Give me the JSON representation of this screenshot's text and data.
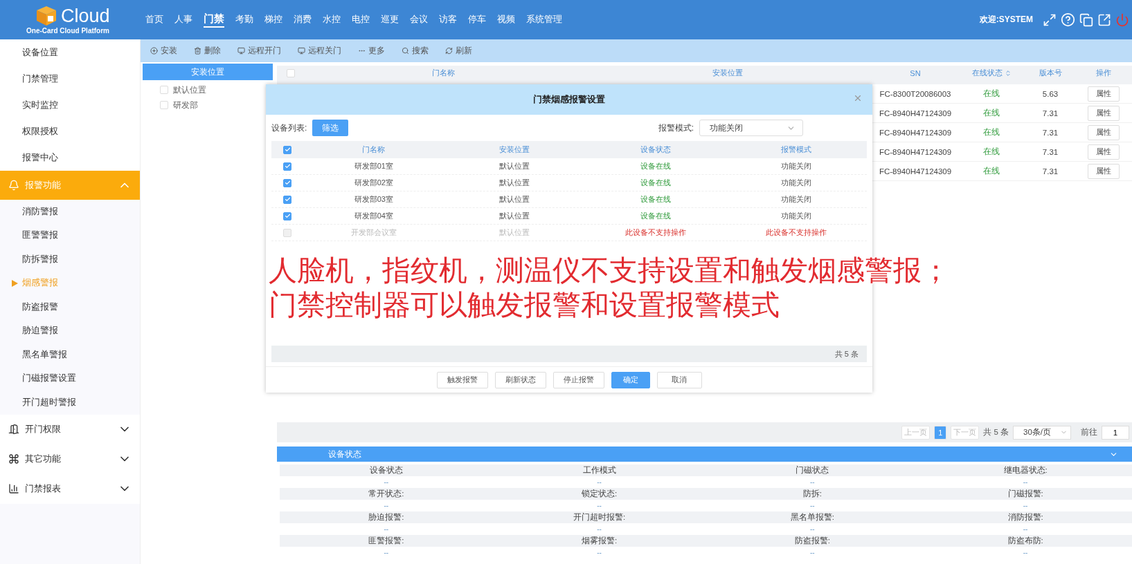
{
  "header": {
    "logo_text": "Cloud",
    "logo_subtitle": "One-Card Cloud Platform",
    "welcome": "欢迎:SYSTEM",
    "nav": [
      {
        "label": "首页",
        "selected": false
      },
      {
        "label": "人事",
        "selected": false
      },
      {
        "label": "门禁",
        "selected": true
      },
      {
        "label": "考勤",
        "selected": false
      },
      {
        "label": "梯控",
        "selected": false
      },
      {
        "label": "消费",
        "selected": false
      },
      {
        "label": "水控",
        "selected": false
      },
      {
        "label": "电控",
        "selected": false
      },
      {
        "label": "巡更",
        "selected": false
      },
      {
        "label": "会议",
        "selected": false
      },
      {
        "label": "访客",
        "selected": false
      },
      {
        "label": "停车",
        "selected": false
      },
      {
        "label": "视频",
        "selected": false
      },
      {
        "label": "系统管理",
        "selected": false
      }
    ]
  },
  "sidebar": {
    "items": [
      {
        "kind": "link",
        "label": "设备位置",
        "selected": false
      },
      {
        "kind": "link",
        "label": "门禁管理",
        "selected": false
      },
      {
        "kind": "link",
        "label": "实时监控",
        "selected": false
      },
      {
        "kind": "link",
        "label": "权限授权",
        "selected": false
      },
      {
        "kind": "link",
        "label": "报警中心",
        "selected": false
      },
      {
        "kind": "group",
        "label": "报警功能",
        "expanded": true,
        "children": [
          {
            "label": "消防警报",
            "selected": false
          },
          {
            "label": "匪警警报",
            "selected": false
          },
          {
            "label": "防拆警报",
            "selected": false
          },
          {
            "label": "烟感警报",
            "selected": true
          },
          {
            "label": "防盗报警",
            "selected": false
          },
          {
            "label": "胁迫警报",
            "selected": false
          },
          {
            "label": "黑名单警报",
            "selected": false
          },
          {
            "label": "门磁报警设置",
            "selected": false
          },
          {
            "label": "开门超时警报",
            "selected": false
          }
        ]
      },
      {
        "kind": "group",
        "label": "开门权限",
        "expanded": false
      },
      {
        "kind": "group",
        "label": "其它功能",
        "expanded": false
      },
      {
        "kind": "group",
        "label": "门禁报表",
        "expanded": false
      }
    ]
  },
  "toolbar": [
    "安装",
    "删除",
    "远程开门",
    "远程关门",
    "更多",
    "搜索",
    "刷新"
  ],
  "tree": {
    "title": "安装位置",
    "items": [
      {
        "label": "默认位置",
        "checked": false
      },
      {
        "label": "研发部",
        "checked": false
      }
    ]
  },
  "table": {
    "all_checked": false,
    "columns": [
      "门名称",
      "安装位置",
      "SN",
      "在线状态",
      "版本号",
      "操作"
    ],
    "rows": [
      {
        "sn": "FC-8300T20086003",
        "status": "在线",
        "version": "5.63",
        "action": "属性"
      },
      {
        "sn": "FC-8940H47124309",
        "status": "在线",
        "version": "7.31",
        "action": "属性"
      },
      {
        "sn": "FC-8940H47124309",
        "status": "在线",
        "version": "7.31",
        "action": "属性"
      },
      {
        "sn": "FC-8940H47124309",
        "status": "在线",
        "version": "7.31",
        "action": "属性"
      },
      {
        "sn": "FC-8940H47124309",
        "status": "在线",
        "version": "7.31",
        "action": "属性"
      }
    ]
  },
  "pagination": {
    "prev": "上一页",
    "prev_disabled": true,
    "pages": [
      {
        "label": "1",
        "selected": true
      }
    ],
    "next": "下一页",
    "next_disabled": true,
    "total": "共 5 条",
    "page_size": "30条/页",
    "goto": "前往",
    "goto_value": "1"
  },
  "status_panel": {
    "title": "设备状态",
    "fields": [
      {
        "label": "设备状态",
        "value": "--"
      },
      {
        "label": "工作模式",
        "value": "--"
      },
      {
        "label": "门磁状态",
        "value": "--"
      },
      {
        "label": "继电器状态:",
        "value": "--"
      },
      {
        "label": "常开状态:",
        "value": "--"
      },
      {
        "label": "锁定状态:",
        "value": "--"
      },
      {
        "label": "防拆:",
        "value": "--"
      },
      {
        "label": "门磁报警:",
        "value": "--"
      },
      {
        "label": "胁迫报警:",
        "value": "--"
      },
      {
        "label": "开门超时报警:",
        "value": "--"
      },
      {
        "label": "黑名单报警:",
        "value": "--"
      },
      {
        "label": "消防报警:",
        "value": "--"
      },
      {
        "label": "匪警报警:",
        "value": "--"
      },
      {
        "label": "烟雾报警:",
        "value": "--"
      },
      {
        "label": "防盗报警:",
        "value": "--"
      },
      {
        "label": "防盗布防:",
        "value": "--"
      }
    ]
  },
  "dialog": {
    "title": "门禁烟感报警设置",
    "list_label": "设备列表:",
    "filter_button": "筛选",
    "mode_label": "报警模式:",
    "mode_value": "功能关闭",
    "all_checked": true,
    "columns": [
      "门名称",
      "安装位置",
      "设备状态",
      "报警模式"
    ],
    "rows": [
      {
        "name": "研发部01室",
        "location": "默认位置",
        "status": "设备在线",
        "mode": "功能关闭",
        "checked": true,
        "disabled": false
      },
      {
        "name": "研发部02室",
        "location": "默认位置",
        "status": "设备在线",
        "mode": "功能关闭",
        "checked": true,
        "disabled": false
      },
      {
        "name": "研发部03室",
        "location": "默认位置",
        "status": "设备在线",
        "mode": "功能关闭",
        "checked": true,
        "disabled": false
      },
      {
        "name": "研发部04室",
        "location": "默认位置",
        "status": "设备在线",
        "mode": "功能关闭",
        "checked": true,
        "disabled": false
      },
      {
        "name": "开发部会议室",
        "location": "默认位置",
        "status": "此设备不支持操作",
        "mode": "此设备不支持操作",
        "checked": false,
        "disabled": true
      }
    ],
    "total": "共 5 条",
    "buttons": [
      {
        "label": "触发报警",
        "kind": "default"
      },
      {
        "label": "刷新状态",
        "kind": "default"
      },
      {
        "label": "停止报警",
        "kind": "default"
      },
      {
        "label": "确定",
        "kind": "primary"
      },
      {
        "label": "取消",
        "kind": "default"
      }
    ]
  },
  "caption": [
    "人脸机，指纹机，测温仪不支持设置和触发烟感警报；",
    "门禁控制器可以触发报警和设置报警模式"
  ]
}
